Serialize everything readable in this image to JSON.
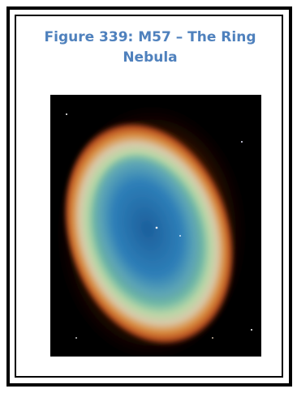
{
  "figure": {
    "caption": "Figure 339: M57 – The Ring Nebula",
    "image_subject": "ring-nebula-m57"
  },
  "colors": {
    "caption": "#4f81bd",
    "border": "#000000",
    "background": "#ffffff"
  }
}
